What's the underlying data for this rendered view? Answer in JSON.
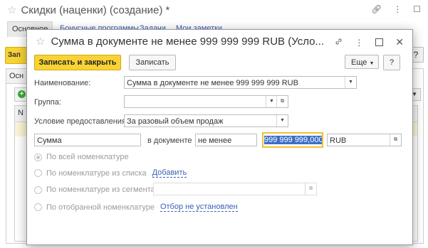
{
  "background_window": {
    "title": "Скидки (наценки) (создание) *",
    "tabs": [
      "Основное",
      "Бонусные программы",
      "Задачи",
      "Мои заметки"
    ],
    "toolbar_button": "Зап",
    "help_label": "?",
    "inner_tab": "Осн",
    "table_header_first": "N"
  },
  "dialog": {
    "title": "Сумма в документе не менее 999 999 999 RUB (Усло...",
    "buttons": {
      "save_close": "Записать и закрыть",
      "save": "Записать",
      "more": "Еще",
      "help": "?"
    },
    "fields": {
      "name_label": "Наименование:",
      "name_value": "Сумма в документе не менее 999 999 999 RUB",
      "group_label": "Группа:",
      "group_value": "",
      "condition_label": "Условие предоставления:",
      "condition_value": "За разовый объем продаж",
      "kind_value": "Сумма",
      "in_doc_label": "в документе",
      "comparison_value": "не менее",
      "amount_value": "999 999 999,000",
      "currency_value": "RUB"
    },
    "radios": [
      {
        "label": "По всей номенклатуре",
        "selected": true,
        "link": ""
      },
      {
        "label": "По номенклатуре из списка",
        "selected": false,
        "link": "Добавить"
      },
      {
        "label": "По номенклатуре из сегмента",
        "selected": false,
        "link": ""
      },
      {
        "label": "По отобранной номенклатуре",
        "selected": false,
        "link": "Отбор не установлен"
      }
    ]
  },
  "colors": {
    "primary_button": "#f9d334",
    "link": "#3a61b5",
    "selection": "#3d6fc7"
  }
}
